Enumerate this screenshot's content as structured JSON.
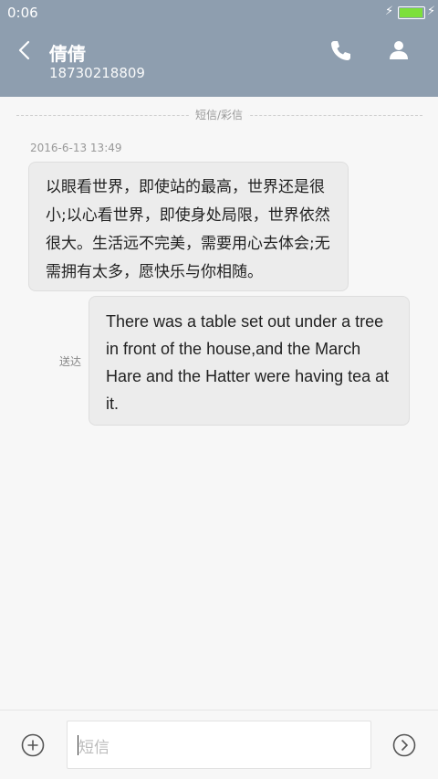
{
  "status_bar": {
    "time": "0:06"
  },
  "header": {
    "name": "倩倩",
    "number": "18730218809"
  },
  "thread": {
    "separator_label": "短信/彩信",
    "timestamp": "2016-6-13 13:49",
    "incoming_text": "以眼看世界，即使站的最高，世界还是很小;以心看世界，即使身处局限，世界依然很大。生活远不完美，需要用心去体会;无需拥有太多，愿快乐与你相随。",
    "outgoing_text": "There was a table set out under a tree in front of the house,and the March Hare and the Hatter were having tea at it.",
    "delivery_status": "送达"
  },
  "composer": {
    "placeholder": "短信"
  },
  "battery": {
    "level": 0.9,
    "color": "#7de03a"
  },
  "colors": {
    "header_bg": "#8e9eaf",
    "bubble_bg": "#ececec",
    "page_bg": "#f7f7f7"
  },
  "icons": [
    "back-arrow-icon",
    "phone-icon",
    "person-icon",
    "add-icon",
    "send-icon",
    "charging-icon",
    "battery-icon"
  ]
}
